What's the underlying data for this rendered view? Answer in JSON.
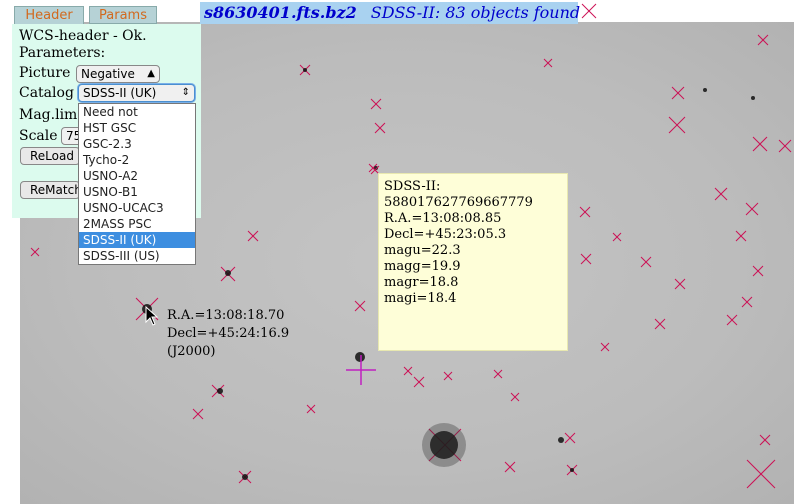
{
  "tabs": {
    "header": "Header",
    "params": "Params"
  },
  "title": {
    "filename": "s8630401.fts.bz2",
    "status": "SDSS-II: 83 objects found"
  },
  "panel": {
    "status": "WCS-header - Ok.",
    "parameters": "Parameters:",
    "picture_label": "Picture",
    "picture_value": "Negative",
    "catalog_label": "Catalog",
    "catalog_value": "SDSS-II (UK)",
    "maglim_label": "Mag.lim",
    "scale_label": "Scale",
    "scale_value": "75",
    "reload_button": "ReLoad",
    "rematch_button": "ReMatch"
  },
  "catalog_options": [
    "Need not",
    "HST GSC",
    "GSC-2.3",
    "Tycho-2",
    "USNO-A2",
    "USNO-B1",
    "USNO-UCAC3",
    "2MASS PSC",
    "SDSS-II (UK)",
    "SDSS-III (US)"
  ],
  "catalog_selected_index": 8,
  "popup": {
    "catalog": "SDSS-II:",
    "id": "588017627769667779",
    "ra": "R.A.=13:08:08.85",
    "decl": "Decl=+45:23:05.3",
    "magu": "magu=22.3",
    "magg": "magg=19.9",
    "magr": "magr=18.8",
    "magi": "magi=18.4"
  },
  "cursor_coords": {
    "ra": "R.A.=13:08:18.70",
    "decl": "Decl=+45:24:16.9",
    "epoch": "(J2000)"
  },
  "colors": {
    "marker": "#cc1155",
    "selected_marker": "#c020c0",
    "title_bg": "#a9d2f0",
    "panel_bg": "#dcfbee",
    "popup_bg": "#fefed8",
    "tab_text": "#d2691e"
  }
}
